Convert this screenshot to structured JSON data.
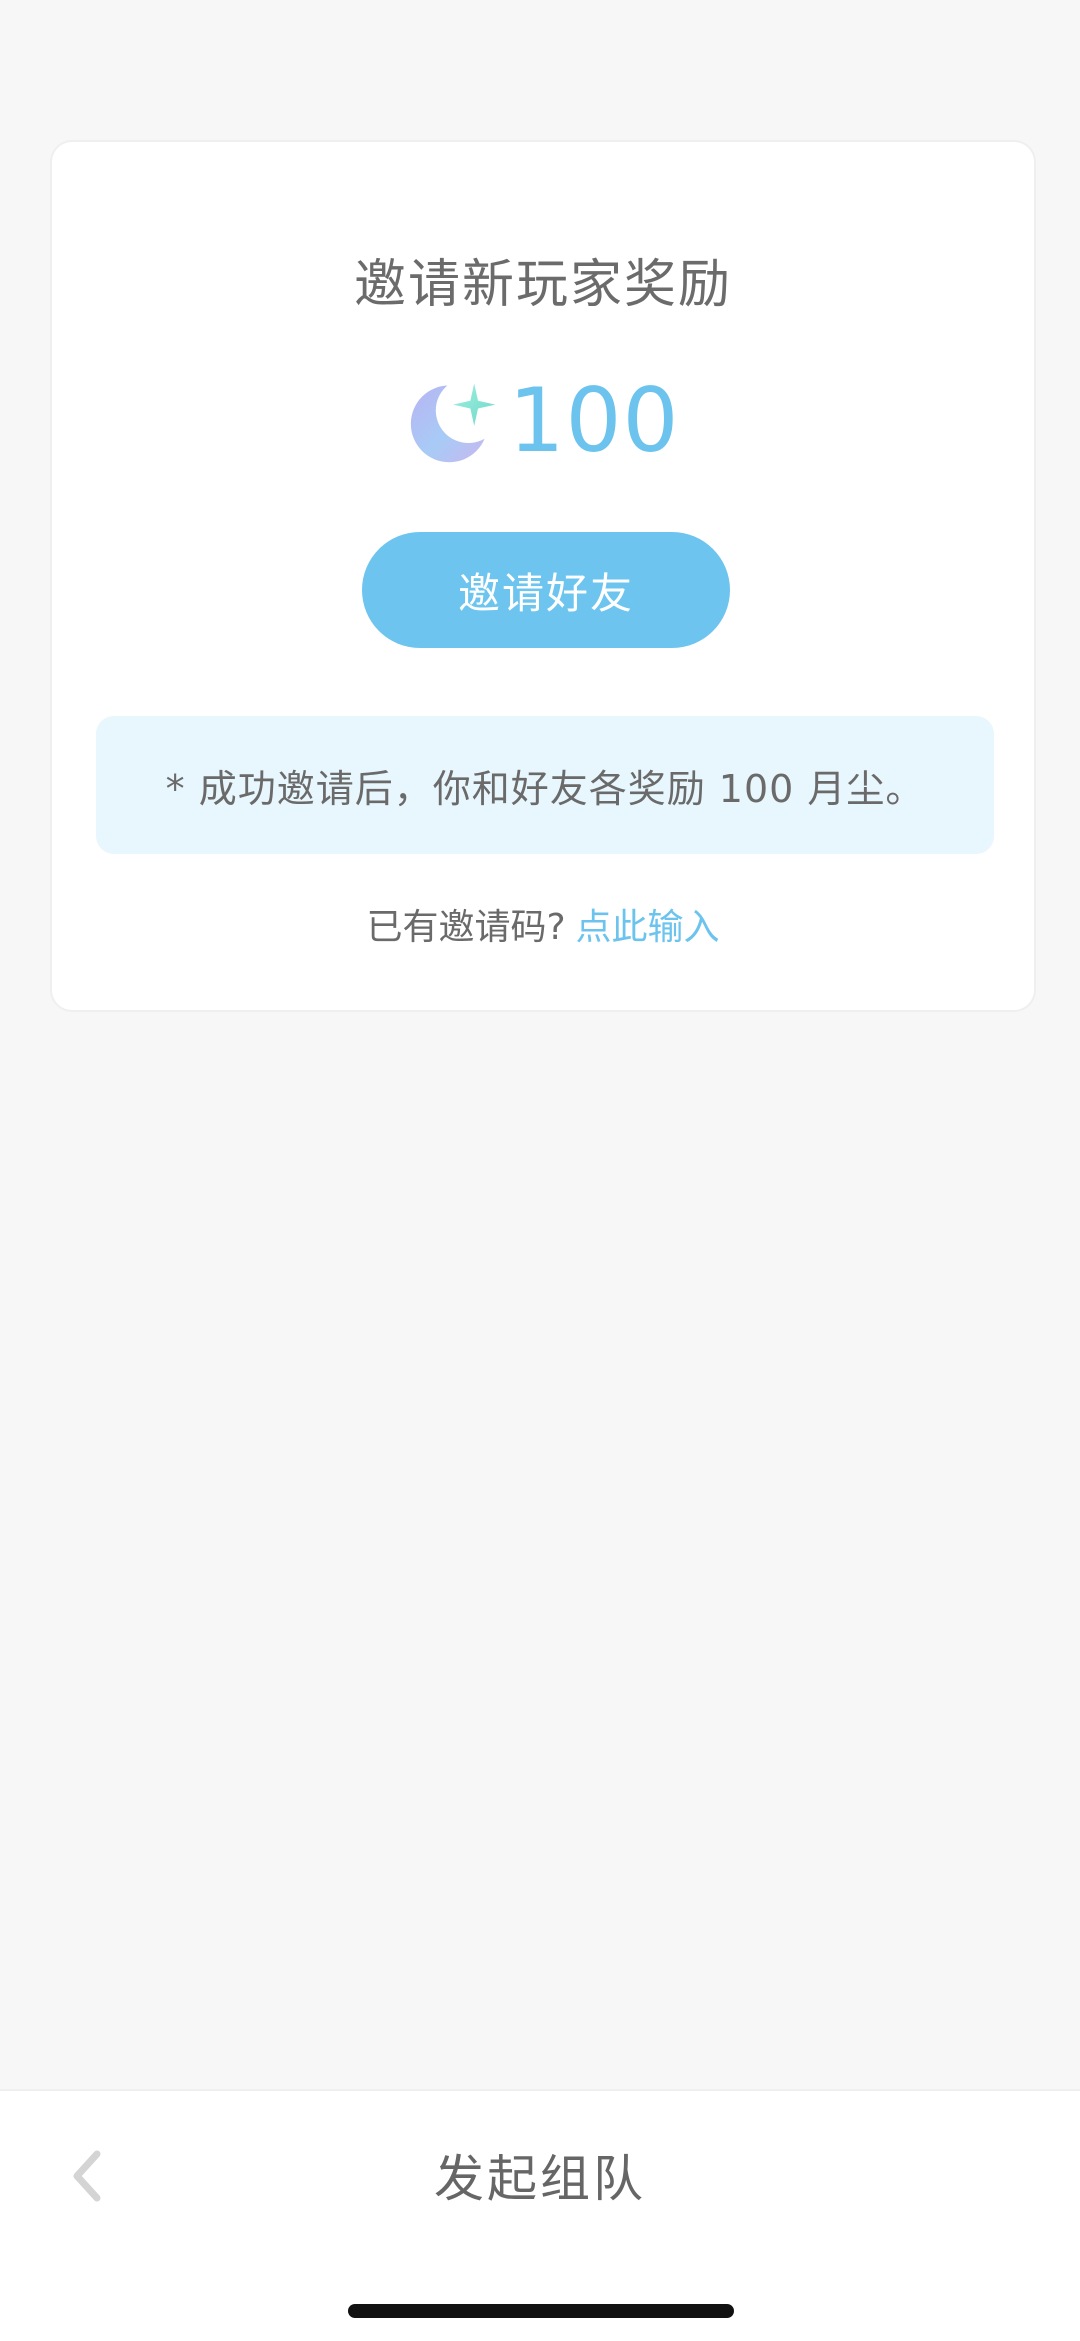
{
  "card": {
    "title": "邀请新玩家奖励",
    "reward_icon": "moon-star-currency-icon",
    "reward_amount": "100",
    "invite_button_label": "邀请好友",
    "note": "* 成功邀请后，你和好友各奖励 100 月尘。",
    "code_prompt": "已有邀请码?",
    "code_link": "点此输入"
  },
  "bottom_bar": {
    "back_icon": "chevron-left-icon",
    "title": "发起组队"
  },
  "colors": {
    "accent": "#6dc5ef",
    "accent_text": "#6cc3ed",
    "note_background": "#e8f6fd",
    "page_background": "#f7f7f8"
  }
}
